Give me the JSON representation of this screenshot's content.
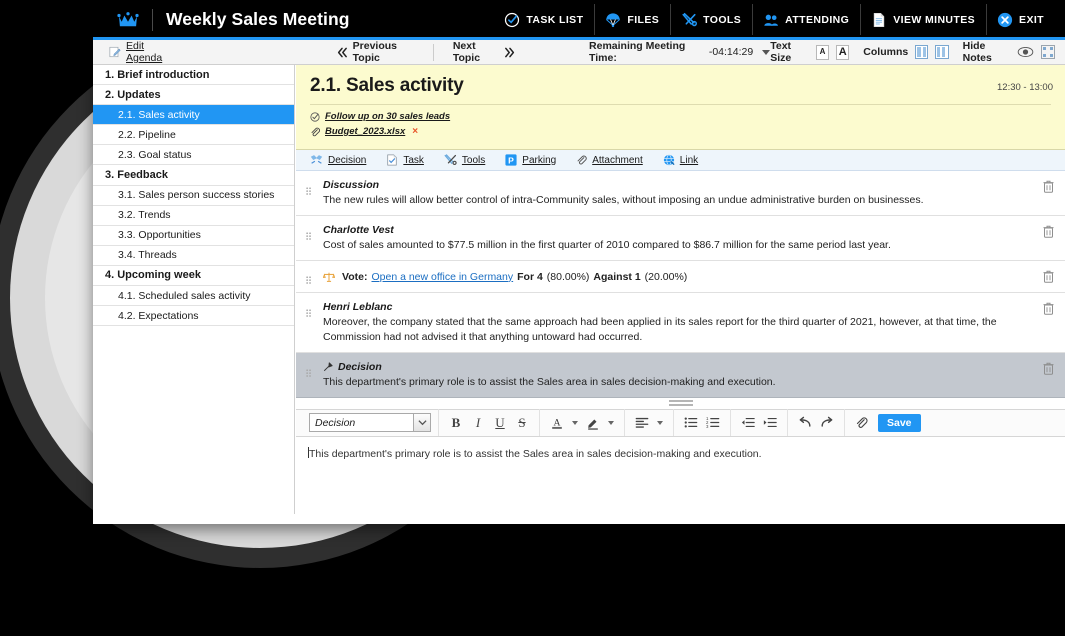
{
  "header": {
    "app_title": "Weekly Sales Meeting",
    "logo_icon": "crown-icon",
    "nav": [
      {
        "label": "TASK LIST",
        "icon": "check-circle-icon"
      },
      {
        "label": "FILES",
        "icon": "parachute-icon"
      },
      {
        "label": "TOOLS",
        "icon": "tools-icon"
      },
      {
        "label": "ATTENDING",
        "icon": "people-icon"
      },
      {
        "label": "VIEW MINUTES",
        "icon": "document-icon"
      },
      {
        "label": "EXIT",
        "icon": "close-circle-icon"
      }
    ]
  },
  "subbar": {
    "edit_agenda": "Edit Agenda",
    "previous_topic": "Previous Topic",
    "next_topic": "Next Topic",
    "remaining_label": "Remaining Meeting Time:",
    "remaining_value": "-04:14:29",
    "text_size_label": "Text Size",
    "text_size_small": "A",
    "text_size_large": "A",
    "columns_label": "Columns",
    "hide_notes_label": "Hide Notes"
  },
  "sidebar": {
    "items": [
      {
        "label": "1. Brief introduction",
        "level": 1,
        "selected": false
      },
      {
        "label": "2. Updates",
        "level": 1,
        "selected": false
      },
      {
        "label": "2.1. Sales activity",
        "level": 2,
        "selected": true
      },
      {
        "label": "2.2. Pipeline",
        "level": 2,
        "selected": false
      },
      {
        "label": "2.3. Goal status",
        "level": 2,
        "selected": false
      },
      {
        "label": "3. Feedback",
        "level": 1,
        "selected": false
      },
      {
        "label": "3.1. Sales person success stories",
        "level": 2,
        "selected": false
      },
      {
        "label": "3.2. Trends",
        "level": 2,
        "selected": false
      },
      {
        "label": "3.3. Opportunities",
        "level": 2,
        "selected": false
      },
      {
        "label": "3.4. Threads",
        "level": 2,
        "selected": false
      },
      {
        "label": "4. Upcoming week",
        "level": 1,
        "selected": false
      },
      {
        "label": "4.1. Scheduled sales activity",
        "level": 2,
        "selected": false
      },
      {
        "label": "4.2. Expectations",
        "level": 2,
        "selected": false
      }
    ]
  },
  "topic": {
    "title": "2.1. Sales activity",
    "time_range": "12:30 - 13:00",
    "task_link": "Follow up on 30 sales leads",
    "attachment_name": "Budget_2023.xlsx",
    "attachment_remove": "×"
  },
  "action_bar": {
    "items": [
      {
        "label": "Decision",
        "icon": "decision-icon"
      },
      {
        "label": "Task",
        "icon": "task-icon"
      },
      {
        "label": "Tools",
        "icon": "tools-icon"
      },
      {
        "label": "Parking",
        "icon": "parking-icon"
      },
      {
        "label": "Attachment",
        "icon": "paperclip-icon"
      },
      {
        "label": "Link",
        "icon": "globe-link-icon"
      }
    ]
  },
  "notes": [
    {
      "type": "note",
      "author": "Discussion",
      "text": "The new rules will allow better control of intra-Community sales, without imposing an undue administrative burden on businesses.",
      "highlighted": false
    },
    {
      "type": "note",
      "author": "Charlotte Vest",
      "text": "Cost of sales amounted to $77.5 million in the first quarter of 2010 compared to $86.7 million for the same period last year.",
      "highlighted": false
    },
    {
      "type": "vote",
      "vote_label": "Vote:",
      "vote_subject": "Open a new office in Germany",
      "for_label": "For 4",
      "for_pct": "(80.00%)",
      "against_label": "Against 1",
      "against_pct": "(20.00%)",
      "highlighted": false
    },
    {
      "type": "note",
      "author": "Henri Leblanc",
      "text": "Moreover, the company stated that the same approach had been applied in its sales report for the third quarter of 2021, however, at that time, the Commission had not advised it that anything untoward had occurred.",
      "highlighted": false
    },
    {
      "type": "note",
      "author": "Decision",
      "text": "This department's primary role  is to assist the Sales area in sales decision-making and execution.",
      "highlighted": true,
      "icon": "decision-arrow-icon"
    }
  ],
  "editor": {
    "type_value": "Decision",
    "bold": "B",
    "italic": "I",
    "underline": "U",
    "strike": "S",
    "save_label": "Save",
    "content": "This department's primary role  is to assist the Sales area in sales decision-making and execution."
  },
  "colors": {
    "accent": "#2196f3",
    "topic_bg": "#fcfbcf",
    "selected_row": "#c3c8cf",
    "action_bar_bg": "#eef5fb"
  }
}
